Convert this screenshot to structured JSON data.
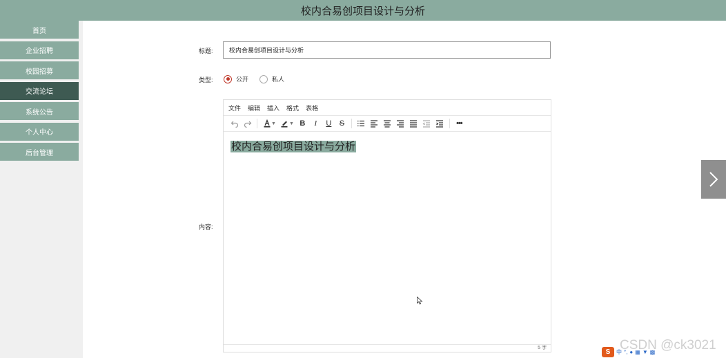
{
  "header": {
    "title": "校内合易创项目设计与分析"
  },
  "sidebar": {
    "items": [
      {
        "label": "首页"
      },
      {
        "label": "企业招聘"
      },
      {
        "label": "校园招募"
      },
      {
        "label": "交流论坛"
      },
      {
        "label": "系统公告"
      },
      {
        "label": "个人中心"
      },
      {
        "label": "后台管理"
      }
    ],
    "active_index": 3
  },
  "form": {
    "title_label": "标题:",
    "title_value": "校内合易创项目设计与分析",
    "type_label": "类型:",
    "type_options": [
      {
        "label": "公开",
        "checked": true
      },
      {
        "label": "私人",
        "checked": false
      }
    ],
    "content_label": "内容:"
  },
  "editor": {
    "menu": [
      "文件",
      "编辑",
      "插入",
      "格式",
      "表格"
    ],
    "toolbar_icons": [
      "undo-icon",
      "redo-icon",
      "font-color-icon",
      "highlight-color-icon",
      "bold-icon",
      "italic-icon",
      "underline-icon",
      "strikethrough-icon",
      "list-icon",
      "align-left-icon",
      "align-center-icon",
      "align-right-icon",
      "align-justify-icon",
      "outdent-icon",
      "indent-icon",
      "more-icon"
    ],
    "content": "校内合易创项目设计与分析",
    "word_count": "5 字"
  },
  "watermark": "CSDN @ck3021",
  "ime": {
    "logo": "S",
    "mode": "中"
  },
  "colors": {
    "primary": "#8aab9f",
    "active": "#3e5a52",
    "radio": "#c0392b"
  }
}
